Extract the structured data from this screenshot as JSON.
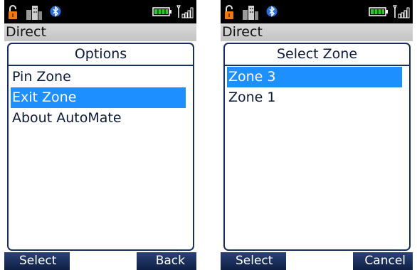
{
  "left": {
    "window_title": "Direct",
    "dialog_title": "Options",
    "items": [
      {
        "label": "Pin Zone",
        "selected": false
      },
      {
        "label": "Exit Zone",
        "selected": true
      },
      {
        "label": "About AutoMate",
        "selected": false
      }
    ],
    "softkey_left": "Select",
    "softkey_right": "Back"
  },
  "right": {
    "window_title": "Direct",
    "dialog_title": "Select Zone",
    "items": [
      {
        "label": "Zone 3",
        "selected": true
      },
      {
        "label": "Zone 1",
        "selected": false
      }
    ],
    "softkey_left": "Select",
    "softkey_right": "Cancel"
  },
  "status_icons": [
    "lock-icon",
    "buildings-icon",
    "bluetooth-icon",
    "battery-icon",
    "signal-icon"
  ],
  "colors": {
    "selection": "#1e8fff",
    "softkey_bar": "#1a2f5e",
    "panel_border": "#1a2f5e"
  }
}
